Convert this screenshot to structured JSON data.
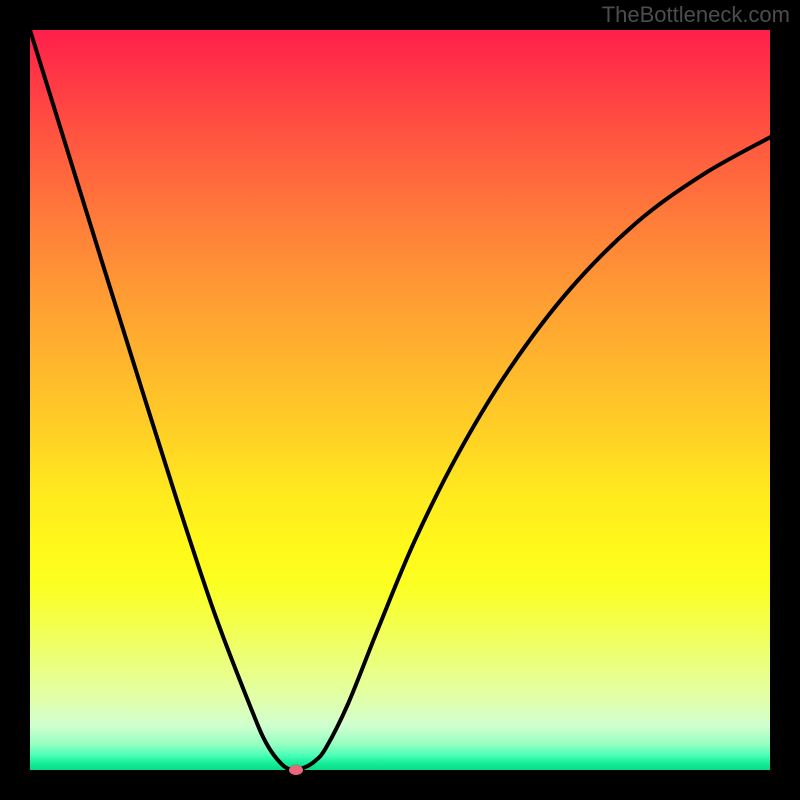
{
  "watermark": "TheBottleneck.com",
  "chart_data": {
    "type": "line",
    "title": "",
    "xlabel": "",
    "ylabel": "",
    "xlim": [
      0,
      1
    ],
    "ylim": [
      0,
      1
    ],
    "series": [
      {
        "name": "curve",
        "x": [
          0.0,
          0.05,
          0.1,
          0.15,
          0.2,
          0.25,
          0.3,
          0.32,
          0.34,
          0.355,
          0.37,
          0.385,
          0.4,
          0.43,
          0.47,
          0.52,
          0.58,
          0.65,
          0.73,
          0.82,
          0.91,
          1.0
        ],
        "y": [
          1.0,
          0.839,
          0.678,
          0.518,
          0.36,
          0.21,
          0.08,
          0.035,
          0.008,
          0.0,
          0.003,
          0.012,
          0.03,
          0.09,
          0.19,
          0.31,
          0.43,
          0.545,
          0.65,
          0.74,
          0.805,
          0.855
        ]
      }
    ],
    "marker": {
      "x": 0.36,
      "y": 0.0
    },
    "gradient_bands": [
      {
        "stop": 0.0,
        "color": "#ff1f4a"
      },
      {
        "stop": 0.5,
        "color": "#ffc028"
      },
      {
        "stop": 0.75,
        "color": "#fbff22"
      },
      {
        "stop": 1.0,
        "color": "#0adb86"
      }
    ]
  }
}
